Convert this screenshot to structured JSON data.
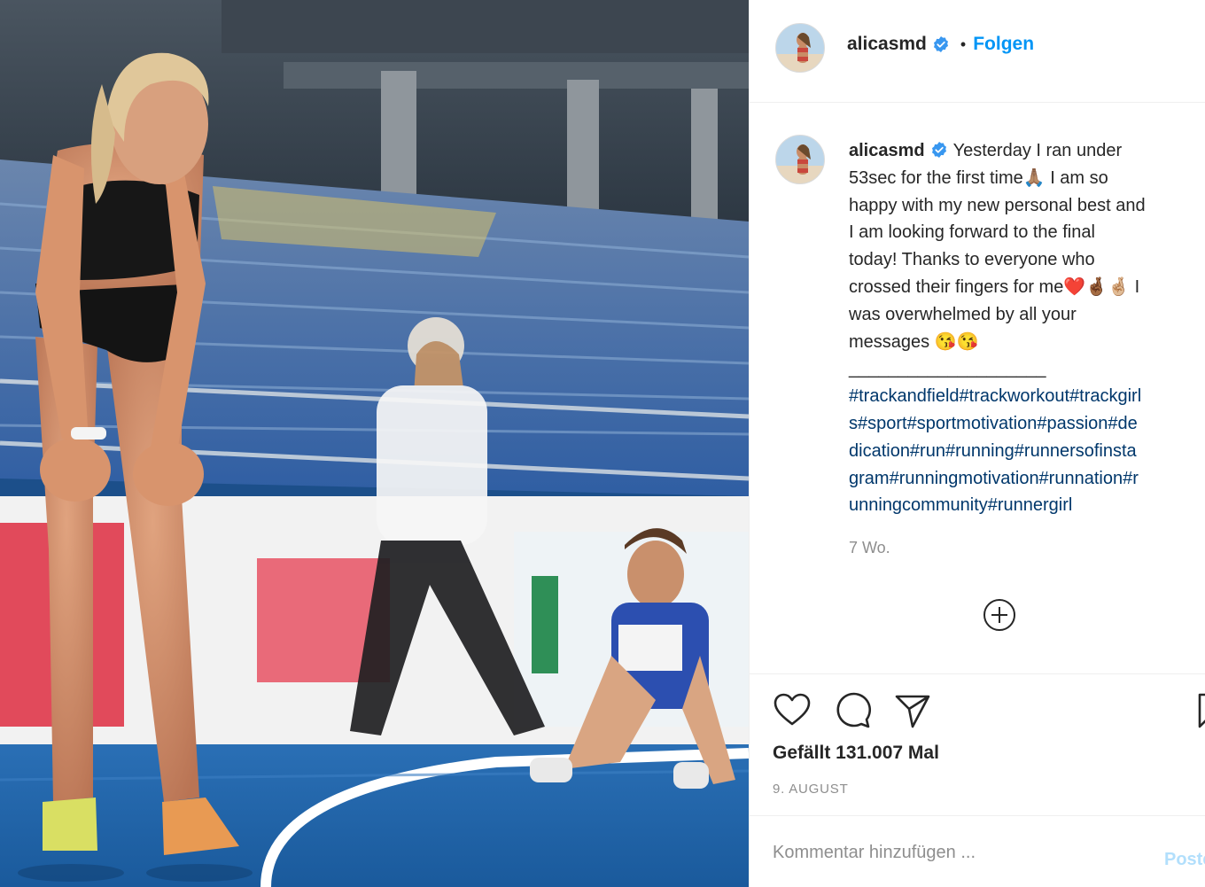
{
  "post": {
    "author": {
      "username": "alicasmd",
      "verified": true,
      "follow_label": "Folgen",
      "separator": "•"
    },
    "caption_lines": [
      "Yesterday I ran under",
      "53sec for the first time🙏🏽 I am so",
      "happy with my new personal best and",
      "I am looking forward to the final",
      "today! Thanks to everyone who",
      "crossed their fingers for me❤️🤞🏾🤞🏼 I",
      "was overwhelmed by all your",
      "messages 😘😘",
      "____________________"
    ],
    "hashtag_lines": [
      "#trackandfield#trackworkout#trackgirl",
      "s#sport#sportmotivation#passion#de",
      "dication#run#running#runnersofinsta",
      "gram#runningmotivation#runnation#r",
      "unningcommunity#runnergirl"
    ],
    "time_ago": "7 Wo.",
    "likes": "Gefällt 131.007 Mal",
    "date": "9. AUGUST",
    "comment_placeholder": "Kommentar hinzufügen ...",
    "post_label": "Posten"
  },
  "icons": {
    "verified": "verified-badge-icon",
    "load_more": "plus-circle-icon",
    "like": "heart-icon",
    "comment": "speech-bubble-icon",
    "share": "paper-plane-icon",
    "save": "bookmark-icon"
  },
  "colors": {
    "accent": "#0095f6",
    "hashtag": "#00376b",
    "muted": "#8e8e8e",
    "border": "#efefef",
    "post_disabled": "#b2dffc"
  }
}
